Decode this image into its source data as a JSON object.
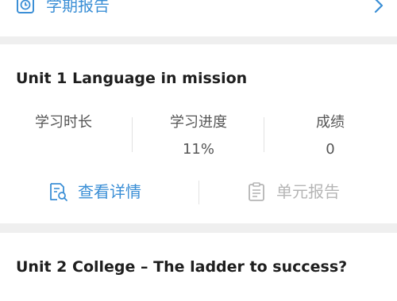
{
  "term_report": {
    "label": "学期报告",
    "icon": "clock-icon",
    "chevron_icon": "chevron-right-icon"
  },
  "units": [
    {
      "title": "Unit 1  Language in mission",
      "stats": {
        "study_time_label": "学习时长",
        "study_time_value": "",
        "progress_label": "学习进度",
        "progress_value": "11%",
        "score_label": "成绩",
        "score_value": "0"
      },
      "actions": {
        "details_label": "查看详情",
        "details_icon": "document-search-icon",
        "report_label": "单元报告",
        "report_icon": "report-icon"
      }
    },
    {
      "title": "Unit 2  College – The ladder to success?"
    }
  ],
  "colors": {
    "accent": "#3b8fd6",
    "disabled": "#b5b5b5",
    "background": "#efefef",
    "card": "#ffffff"
  }
}
